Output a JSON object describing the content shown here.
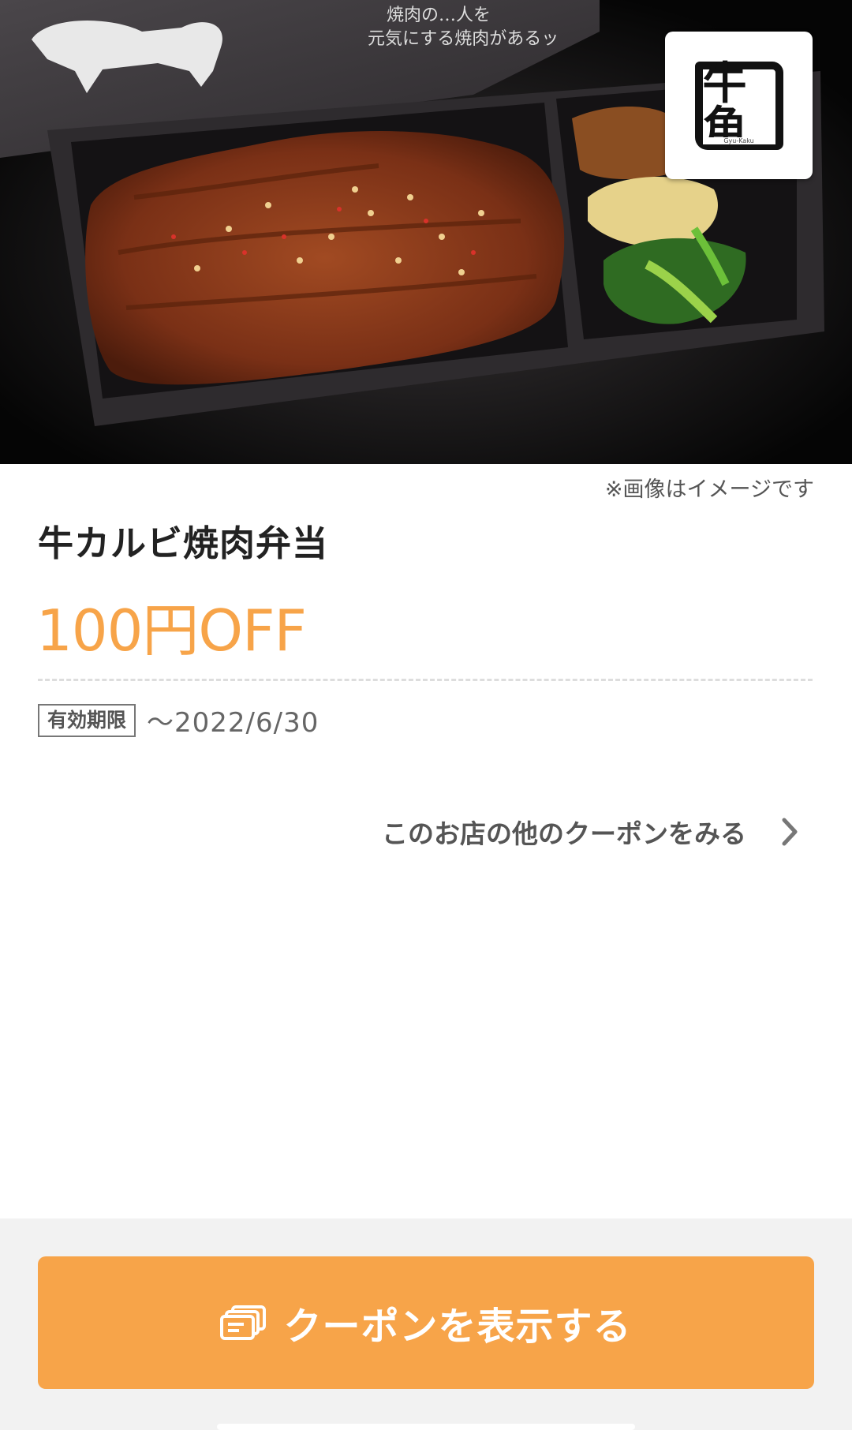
{
  "hero": {
    "image_label": "牛カルビ焼肉弁当 image",
    "logo_text": "牛角",
    "logo_subtext": "Gyu-Kaku",
    "caption": "※画像はイメージです"
  },
  "coupon": {
    "title": "牛カルビ焼肉弁当",
    "discount": "100円OFF",
    "validity_label": "有効期限",
    "validity_date": "〜2022/6/30"
  },
  "links": {
    "more_coupons": "このお店の他のクーポンをみる"
  },
  "footer": {
    "show_coupon_button": "クーポンを表示する"
  },
  "colors": {
    "accent": "#f7a449",
    "bottom_bar": "#f2f2f2"
  },
  "icons": {
    "cta": "coupon-cards-icon",
    "link": "chevron-right-icon"
  }
}
